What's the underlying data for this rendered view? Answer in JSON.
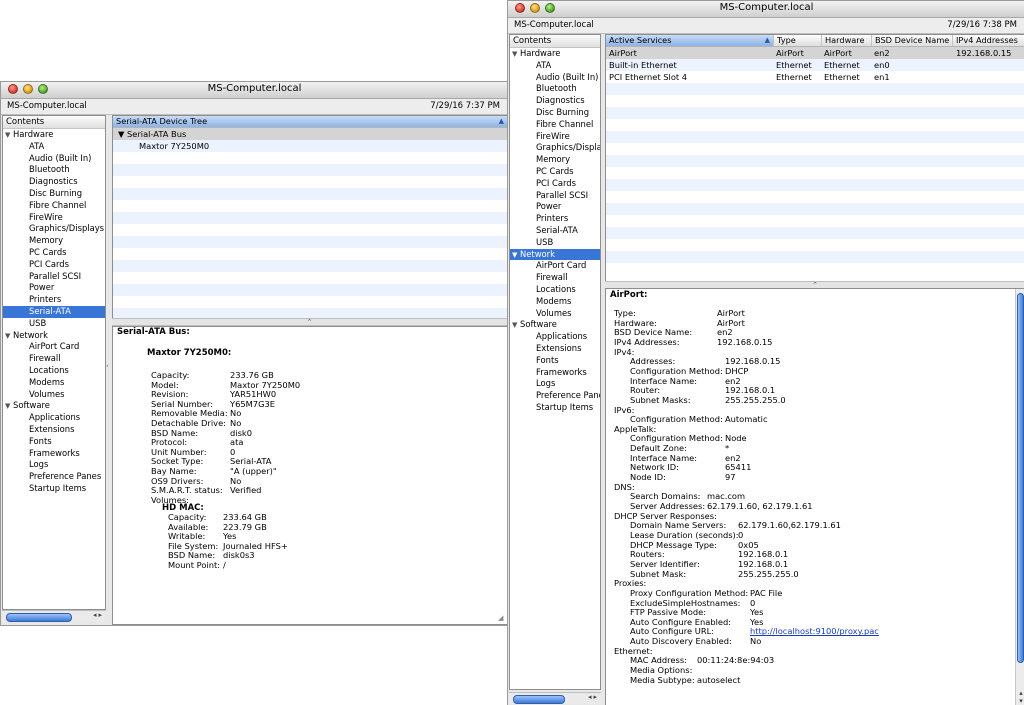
{
  "window_left": {
    "title": "MS-Computer.local",
    "computer_name": "MS-Computer.local",
    "date": "7/29/16 7:37 PM",
    "sidebar": {
      "header": "Contents",
      "items": [
        {
          "label": "Hardware",
          "kind": "cat"
        },
        {
          "label": "ATA",
          "kind": "sub"
        },
        {
          "label": "Audio (Built In)",
          "kind": "sub"
        },
        {
          "label": "Bluetooth",
          "kind": "sub"
        },
        {
          "label": "Diagnostics",
          "kind": "sub"
        },
        {
          "label": "Disc Burning",
          "kind": "sub"
        },
        {
          "label": "Fibre Channel",
          "kind": "sub"
        },
        {
          "label": "FireWire",
          "kind": "sub"
        },
        {
          "label": "Graphics/Displays",
          "kind": "sub"
        },
        {
          "label": "Memory",
          "kind": "sub"
        },
        {
          "label": "PC Cards",
          "kind": "sub"
        },
        {
          "label": "PCI Cards",
          "kind": "sub"
        },
        {
          "label": "Parallel SCSI",
          "kind": "sub"
        },
        {
          "label": "Power",
          "kind": "sub"
        },
        {
          "label": "Printers",
          "kind": "sub"
        },
        {
          "label": "Serial-ATA",
          "kind": "sub",
          "selected": true
        },
        {
          "label": "USB",
          "kind": "sub"
        },
        {
          "label": "Network",
          "kind": "cat"
        },
        {
          "label": "AirPort Card",
          "kind": "sub"
        },
        {
          "label": "Firewall",
          "kind": "sub"
        },
        {
          "label": "Locations",
          "kind": "sub"
        },
        {
          "label": "Modems",
          "kind": "sub"
        },
        {
          "label": "Volumes",
          "kind": "sub"
        },
        {
          "label": "Software",
          "kind": "cat"
        },
        {
          "label": "Applications",
          "kind": "sub"
        },
        {
          "label": "Extensions",
          "kind": "sub"
        },
        {
          "label": "Fonts",
          "kind": "sub"
        },
        {
          "label": "Frameworks",
          "kind": "sub"
        },
        {
          "label": "Logs",
          "kind": "sub"
        },
        {
          "label": "Preference Panes",
          "kind": "sub"
        },
        {
          "label": "Startup Items",
          "kind": "sub"
        }
      ]
    },
    "tree": {
      "column_header": "Serial-ATA Device Tree",
      "bus": "Serial-ATA Bus",
      "device": "Maxtor 7Y250M0"
    },
    "detail": {
      "heading": "Serial-ATA Bus:",
      "device": "Maxtor 7Y250M0:",
      "fields": [
        {
          "k": "Capacity:",
          "v": "233.76 GB"
        },
        {
          "k": "Model:",
          "v": "Maxtor 7Y250M0"
        },
        {
          "k": "Revision:",
          "v": "YAR51HW0"
        },
        {
          "k": "Serial Number:",
          "v": "Y65M7G3E"
        },
        {
          "k": "Removable Media:",
          "v": "No"
        },
        {
          "k": "Detachable Drive:",
          "v": "No"
        },
        {
          "k": "BSD Name:",
          "v": "disk0"
        },
        {
          "k": "Protocol:",
          "v": "ata"
        },
        {
          "k": "Unit Number:",
          "v": "0"
        },
        {
          "k": "Socket Type:",
          "v": "Serial-ATA"
        },
        {
          "k": "Bay Name:",
          "v": "\"A (upper)\""
        },
        {
          "k": "OS9 Drivers:",
          "v": "No"
        },
        {
          "k": "S.M.A.R.T. status:",
          "v": "Verified"
        },
        {
          "k": "Volumes:",
          "v": ""
        }
      ],
      "volume_name": "HD MAC:",
      "volume_fields": [
        {
          "k": "Capacity:",
          "v": "233.64 GB"
        },
        {
          "k": "Available:",
          "v": "223.79 GB"
        },
        {
          "k": "Writable:",
          "v": "Yes"
        },
        {
          "k": "File System:",
          "v": "Journaled HFS+"
        },
        {
          "k": "BSD Name:",
          "v": "disk0s3"
        },
        {
          "k": "Mount Point:",
          "v": "/"
        }
      ]
    }
  },
  "window_right": {
    "title": "MS-Computer.local",
    "computer_name": "MS-Computer.local",
    "date": "7/29/16 7:38 PM",
    "sidebar": {
      "header": "Contents",
      "items": [
        {
          "label": "Hardware",
          "kind": "cat"
        },
        {
          "label": "ATA",
          "kind": "sub"
        },
        {
          "label": "Audio (Built In)",
          "kind": "sub"
        },
        {
          "label": "Bluetooth",
          "kind": "sub"
        },
        {
          "label": "Diagnostics",
          "kind": "sub"
        },
        {
          "label": "Disc Burning",
          "kind": "sub"
        },
        {
          "label": "Fibre Channel",
          "kind": "sub"
        },
        {
          "label": "FireWire",
          "kind": "sub"
        },
        {
          "label": "Graphics/Displays",
          "kind": "sub"
        },
        {
          "label": "Memory",
          "kind": "sub"
        },
        {
          "label": "PC Cards",
          "kind": "sub"
        },
        {
          "label": "PCI Cards",
          "kind": "sub"
        },
        {
          "label": "Parallel SCSI",
          "kind": "sub"
        },
        {
          "label": "Power",
          "kind": "sub"
        },
        {
          "label": "Printers",
          "kind": "sub"
        },
        {
          "label": "Serial-ATA",
          "kind": "sub"
        },
        {
          "label": "USB",
          "kind": "sub"
        },
        {
          "label": "Network",
          "kind": "cat",
          "selected": true
        },
        {
          "label": "AirPort Card",
          "kind": "sub"
        },
        {
          "label": "Firewall",
          "kind": "sub"
        },
        {
          "label": "Locations",
          "kind": "sub"
        },
        {
          "label": "Modems",
          "kind": "sub"
        },
        {
          "label": "Volumes",
          "kind": "sub"
        },
        {
          "label": "Software",
          "kind": "cat"
        },
        {
          "label": "Applications",
          "kind": "sub"
        },
        {
          "label": "Extensions",
          "kind": "sub"
        },
        {
          "label": "Fonts",
          "kind": "sub"
        },
        {
          "label": "Frameworks",
          "kind": "sub"
        },
        {
          "label": "Logs",
          "kind": "sub"
        },
        {
          "label": "Preference Panes",
          "kind": "sub"
        },
        {
          "label": "Startup Items",
          "kind": "sub"
        }
      ]
    },
    "services": {
      "columns": [
        "Active Services",
        "Type",
        "Hardware",
        "BSD Device Name",
        "IPv4 Addresses"
      ],
      "rows": [
        [
          "AirPort",
          "AirPort",
          "AirPort",
          "en2",
          "192.168.0.15"
        ],
        [
          "Built-in Ethernet",
          "Ethernet",
          "Ethernet",
          "en0",
          ""
        ],
        [
          "PCI Ethernet Slot 4",
          "Ethernet",
          "Ethernet",
          "en1",
          ""
        ]
      ]
    },
    "detail": {
      "heading": "AirPort:",
      "lines": [
        {
          "indent": 0,
          "k": "Type:",
          "v": "AirPort"
        },
        {
          "indent": 0,
          "k": "Hardware:",
          "v": "AirPort"
        },
        {
          "indent": 0,
          "k": "BSD Device Name:",
          "v": "en2"
        },
        {
          "indent": 0,
          "k": "IPv4 Addresses:",
          "v": "192.168.0.15"
        },
        {
          "indent": 0,
          "k": "IPv4:",
          "v": ""
        },
        {
          "indent": 1,
          "k": "Addresses:",
          "v": "192.168.0.15"
        },
        {
          "indent": 1,
          "k": "Configuration Method:",
          "v": "DHCP"
        },
        {
          "indent": 1,
          "k": "Interface Name:",
          "v": "en2"
        },
        {
          "indent": 1,
          "k": "Router:",
          "v": "192.168.0.1"
        },
        {
          "indent": 1,
          "k": "Subnet Masks:",
          "v": "255.255.255.0"
        },
        {
          "indent": 0,
          "k": "IPv6:",
          "v": ""
        },
        {
          "indent": 1,
          "k": "Configuration Method:",
          "v": "Automatic"
        },
        {
          "indent": 0,
          "k": "AppleTalk:",
          "v": ""
        },
        {
          "indent": 1,
          "k": "Configuration Method:",
          "v": "Node"
        },
        {
          "indent": 1,
          "k": "Default Zone:",
          "v": "*"
        },
        {
          "indent": 1,
          "k": "Interface Name:",
          "v": "en2"
        },
        {
          "indent": 1,
          "k": "Network ID:",
          "v": "65411"
        },
        {
          "indent": 1,
          "k": "Node ID:",
          "v": "97"
        },
        {
          "indent": 0,
          "k": "DNS:",
          "v": ""
        },
        {
          "indent": 2,
          "k": "Search Domains:",
          "v": "mac.com"
        },
        {
          "indent": 2,
          "k": "Server Addresses:",
          "v": "62.179.1.60, 62.179.1.61"
        },
        {
          "indent": 0,
          "k": "DHCP Server Responses:",
          "v": ""
        },
        {
          "indent": 2,
          "k": "Domain Name Servers:",
          "v": "62.179.1.60,62.179.1.61"
        },
        {
          "indent": 2,
          "k": "Lease Duration (seconds):",
          "v": "0"
        },
        {
          "indent": 2,
          "k": "DHCP Message Type:",
          "v": "0x05"
        },
        {
          "indent": 2,
          "k": "Routers:",
          "v": "192.168.0.1"
        },
        {
          "indent": 2,
          "k": "Server Identifier:",
          "v": "192.168.0.1"
        },
        {
          "indent": 2,
          "k": "Subnet Mask:",
          "v": "255.255.255.0"
        },
        {
          "indent": 0,
          "k": "Proxies:",
          "v": ""
        },
        {
          "indent": 3,
          "k": "Proxy Configuration Method:",
          "v": "PAC File"
        },
        {
          "indent": 3,
          "k": "ExcludeSimpleHostnames:",
          "v": "0"
        },
        {
          "indent": 3,
          "k": "FTP Passive Mode:",
          "v": "Yes"
        },
        {
          "indent": 3,
          "k": "Auto Configure Enabled:",
          "v": "Yes"
        },
        {
          "indent": 3,
          "k": "Auto Configure URL:",
          "v": "http://localhost:9100/proxy.pac",
          "link": true
        },
        {
          "indent": 3,
          "k": "Auto Discovery Enabled:",
          "v": "No"
        },
        {
          "indent": 0,
          "k": "Ethernet:",
          "v": ""
        },
        {
          "indent": 2,
          "k": "MAC Address:",
          "v": "00:11:24:8e:94:03"
        },
        {
          "indent": 2,
          "k": "Media Options:",
          "v": ""
        },
        {
          "indent": 2,
          "k": "Media Subtype:",
          "v": "autoselect"
        }
      ]
    }
  },
  "colors": {
    "selection": "#3875d7",
    "sorted_header": "#8db3e6",
    "stripe": "#edf3fe",
    "link": "#1a3eb8"
  }
}
